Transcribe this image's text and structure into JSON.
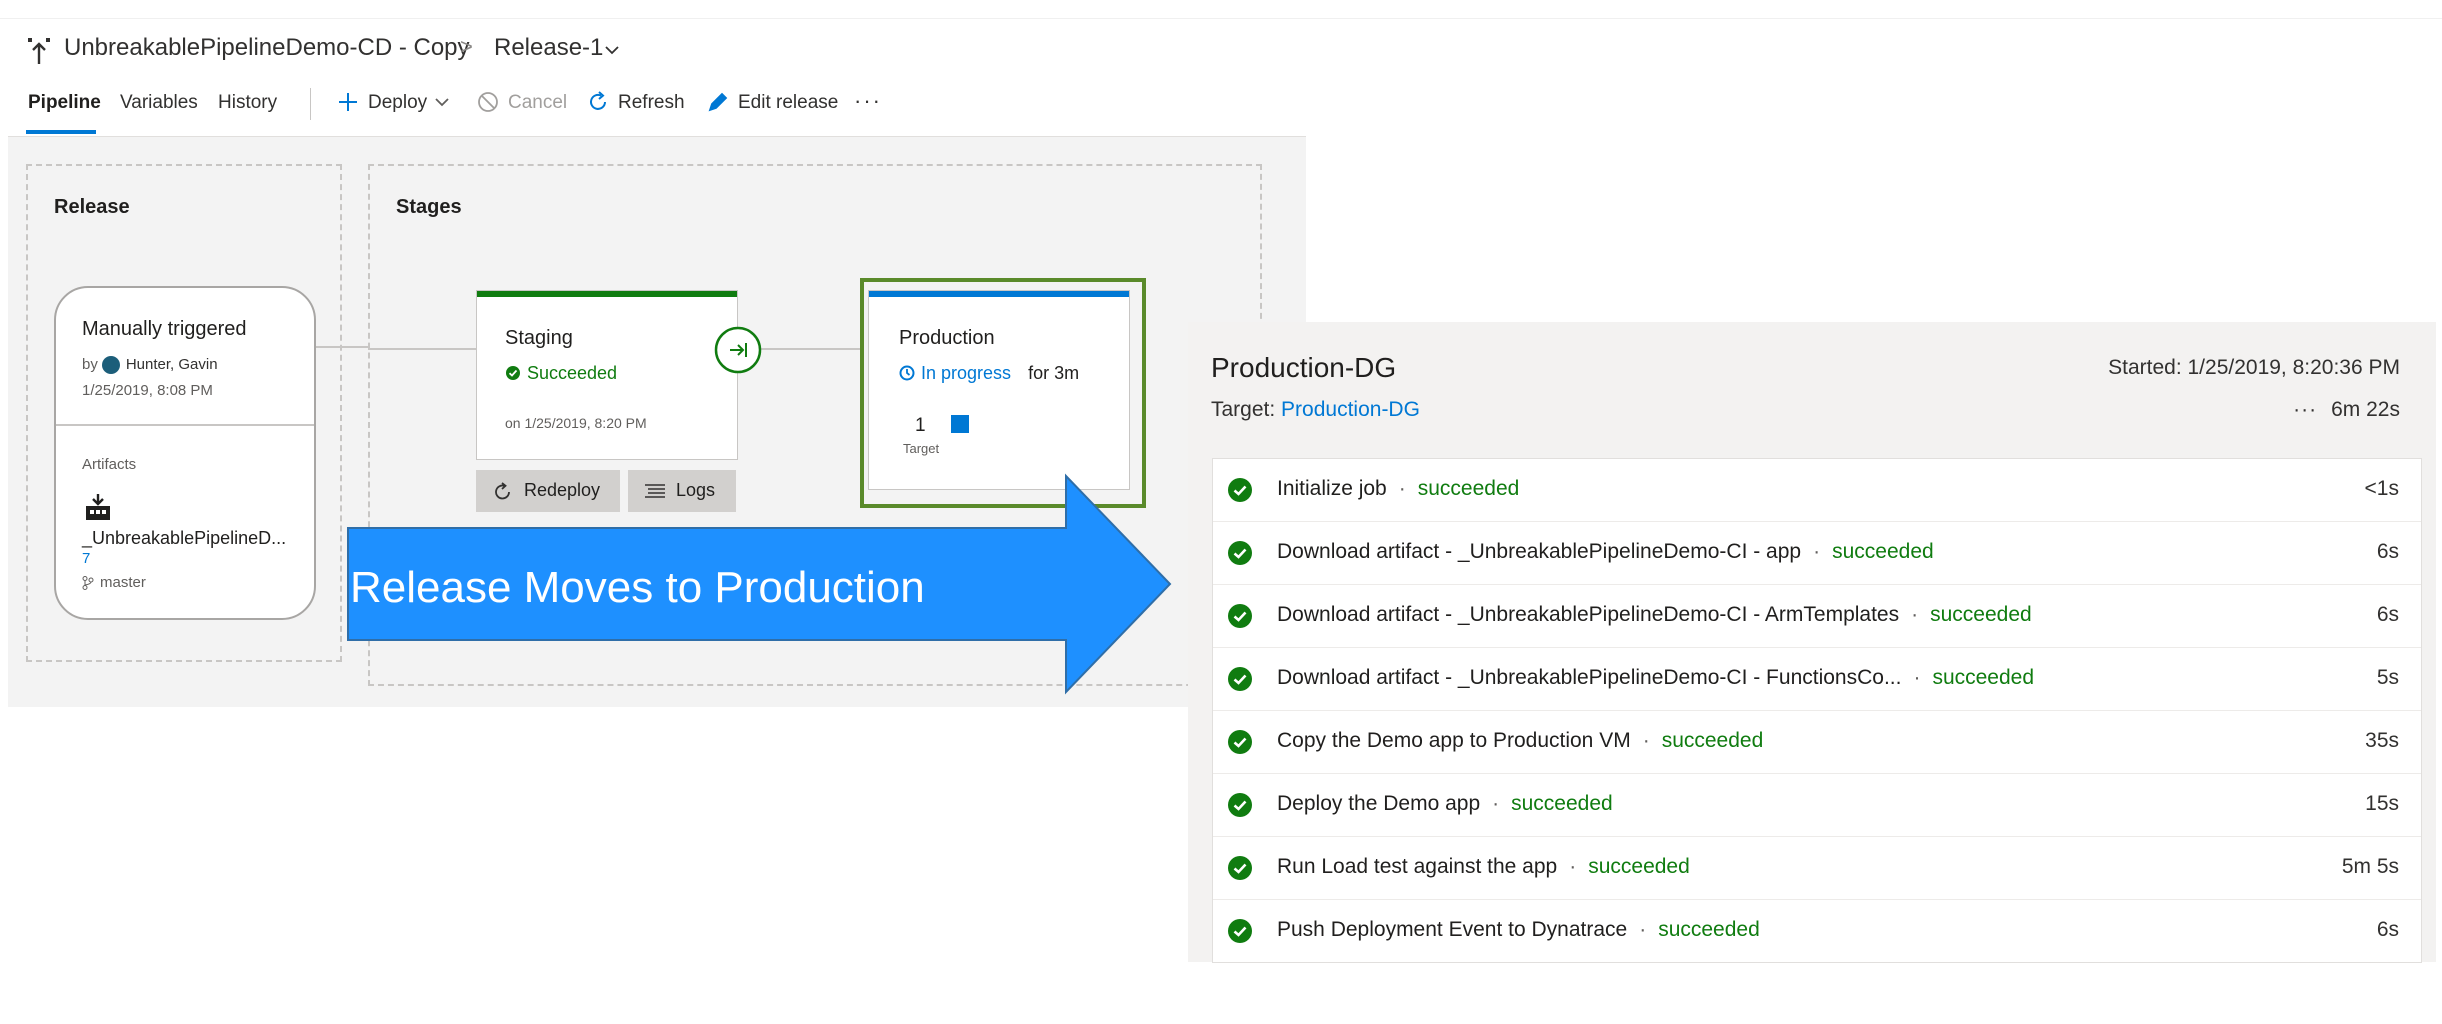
{
  "header": {
    "pipeline_name": "UnbreakablePipelineDemo-CD - Copy",
    "separator": ">",
    "release_name": "Release-1"
  },
  "tabs": [
    {
      "label": "Pipeline",
      "active": true
    },
    {
      "label": "Variables",
      "active": false
    },
    {
      "label": "History",
      "active": false
    }
  ],
  "toolbar": {
    "deploy": "Deploy",
    "cancel": "Cancel",
    "refresh": "Refresh",
    "edit_release": "Edit release",
    "more": "···"
  },
  "release_section": {
    "label": "Release",
    "card": {
      "trigger": "Manually triggered",
      "by_prefix": "by",
      "author": "Hunter, Gavin",
      "date": "1/25/2019, 8:08 PM",
      "artifacts_label": "Artifacts",
      "artifact_name": "_UnbreakablePipelineD...",
      "artifact_version": "7",
      "branch": "master"
    }
  },
  "stages_section": {
    "label": "Stages",
    "staging": {
      "name": "Staging",
      "status": "Succeeded",
      "date": "on 1/25/2019, 8:20 PM",
      "redeploy": "Redeploy",
      "logs": "Logs"
    },
    "production": {
      "name": "Production",
      "status": "In progress",
      "duration": "for 3m",
      "target_count": "1",
      "target_label": "Target"
    }
  },
  "annotation": {
    "text": "Release Moves to Production"
  },
  "detail_panel": {
    "title": "Production-DG",
    "target_label": "Target:",
    "target_value": "Production-DG",
    "started": "Started: 1/25/2019, 8:20:36 PM",
    "more": "···",
    "duration": "6m 22s",
    "steps": [
      {
        "name": "Initialize job",
        "status": "succeeded",
        "time": "<1s"
      },
      {
        "name": "Download artifact - _UnbreakablePipelineDemo-CI - app",
        "status": "succeeded",
        "time": "6s"
      },
      {
        "name": "Download artifact - _UnbreakablePipelineDemo-CI - ArmTemplates",
        "status": "succeeded",
        "time": "6s"
      },
      {
        "name": "Download artifact - _UnbreakablePipelineDemo-CI - FunctionsCo...",
        "status": "succeeded",
        "time": "5s"
      },
      {
        "name": "Copy the Demo app to Production VM",
        "status": "succeeded",
        "time": "35s"
      },
      {
        "name": "Deploy the Demo app",
        "status": "succeeded",
        "time": "15s"
      },
      {
        "name": "Run Load test against the app",
        "status": "succeeded",
        "time": "5m 5s"
      },
      {
        "name": "Push Deployment Event to Dynatrace",
        "status": "succeeded",
        "time": "6s"
      }
    ]
  },
  "colors": {
    "accent": "#0078d4",
    "success": "#107c10",
    "arrow": "#1e90ff",
    "highlight_border": "#5a8a2a"
  }
}
